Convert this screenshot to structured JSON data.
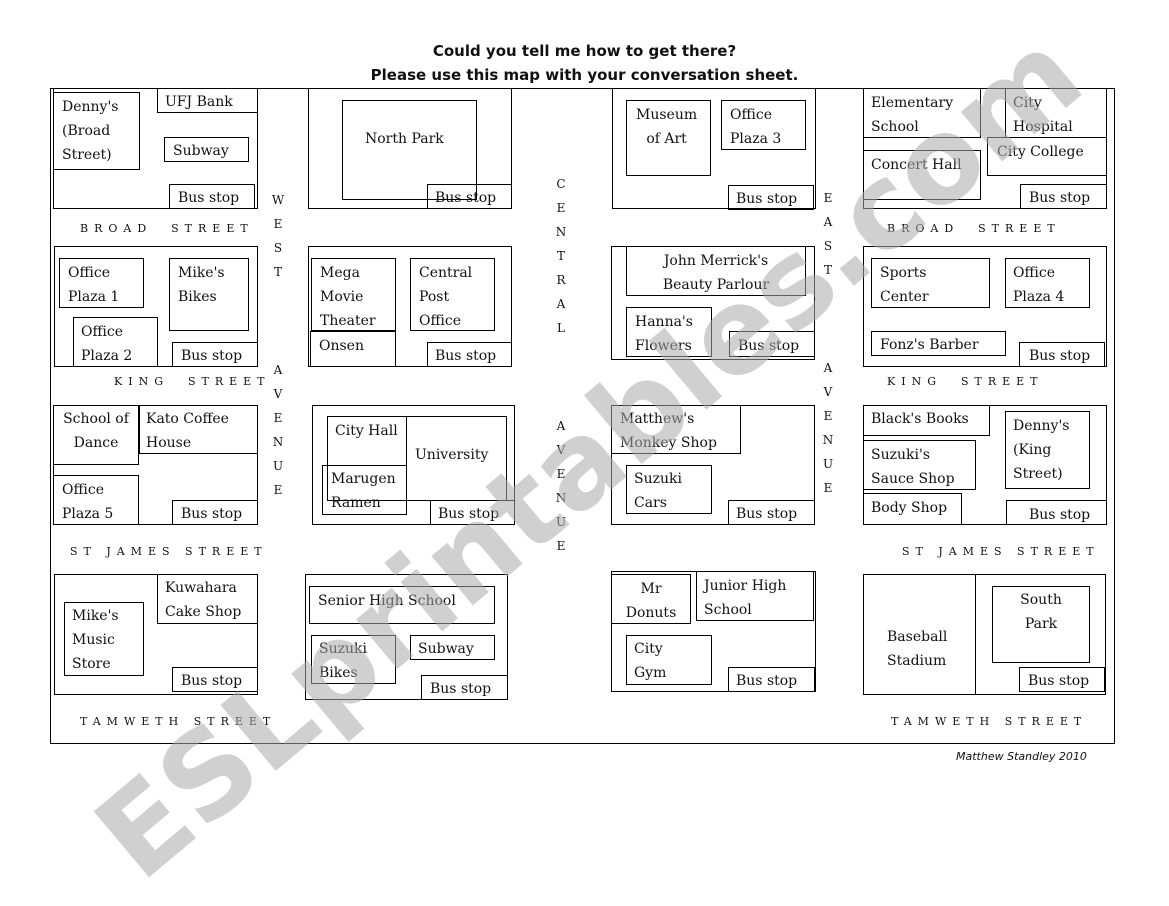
{
  "header": {
    "line1": "Could you tell me how to get there?",
    "line2": "Please use this map with your conversation sheet."
  },
  "streets": {
    "broad": "BROAD  STREET",
    "king": "KING  STREET",
    "st_james": "ST JAMES STREET",
    "tamweth": "TAMWETH STREET"
  },
  "avenues": {
    "west_1": "WEST",
    "west_2": "AVENUE",
    "central_1": "CENTRAL",
    "central_2": "AVENUE",
    "east_1": "EAST",
    "east_2": "AVENUE"
  },
  "places": {
    "dennys_broad": "Denny's\n(Broad\nStreet)",
    "ufj_bank": "UFJ Bank",
    "subway_1": "Subway",
    "north_park": "North Park",
    "museum_of_art": "Museum\nof Art",
    "office_plaza_3": "Office\nPlaza 3",
    "elementary_school": "Elementary\nSchool",
    "city_hospital": "City\nHospital",
    "city_college": "City College",
    "concert_hall": "Concert Hall",
    "office_plaza_1": "Office\nPlaza 1",
    "mikes_bikes": "Mike's\nBikes",
    "office_plaza_2": "Office\nPlaza 2",
    "mega_movie_theater": "Mega\nMovie\nTheater",
    "central_post_office": "Central\nPost\nOffice",
    "onsen": "Onsen",
    "john_merricks": "John Merrick's\nBeauty Parlour",
    "hannas_flowers": "Hanna's\nFlowers",
    "sports_center": "Sports\nCenter",
    "office_plaza_4": "Office\nPlaza 4",
    "fonzs_barber": "Fonz's Barber",
    "school_of_dance": "School of\nDance",
    "kato_coffee": "Kato    Coffee\nHouse",
    "office_plaza_5": "Office\nPlaza 5",
    "city_hall": "City Hall",
    "university": "University",
    "marugen_ramen": "Marugen\nRamen",
    "matthews_monkey": "Matthew's\nMonkey Shop",
    "suzuki_cars": "Suzuki\nCars",
    "blacks_books": "Black's Books",
    "suzukis_sauce": "Suzuki's\nSauce Shop",
    "dennys_king": "Denny's\n(King\nStreet)",
    "body_shop": "Body Shop",
    "kuwahara_cake": "Kuwahara\nCake Shop",
    "mikes_music": "Mike's\nMusic\nStore",
    "senior_high": "Senior High School",
    "suzuki_bikes": "Suzuki\nBikes",
    "subway_2": "Subway",
    "mr_donuts": "Mr\nDonuts",
    "junior_high": "Junior   High\nSchool",
    "city_gym": "City\nGym",
    "baseball_stadium": "Baseball\nStadium",
    "south_park": "South\nPark",
    "bus_stop": "Bus stop"
  },
  "footer": {
    "credit": "Matthew  Standley 2010",
    "watermark": "ESLprintables.com"
  }
}
